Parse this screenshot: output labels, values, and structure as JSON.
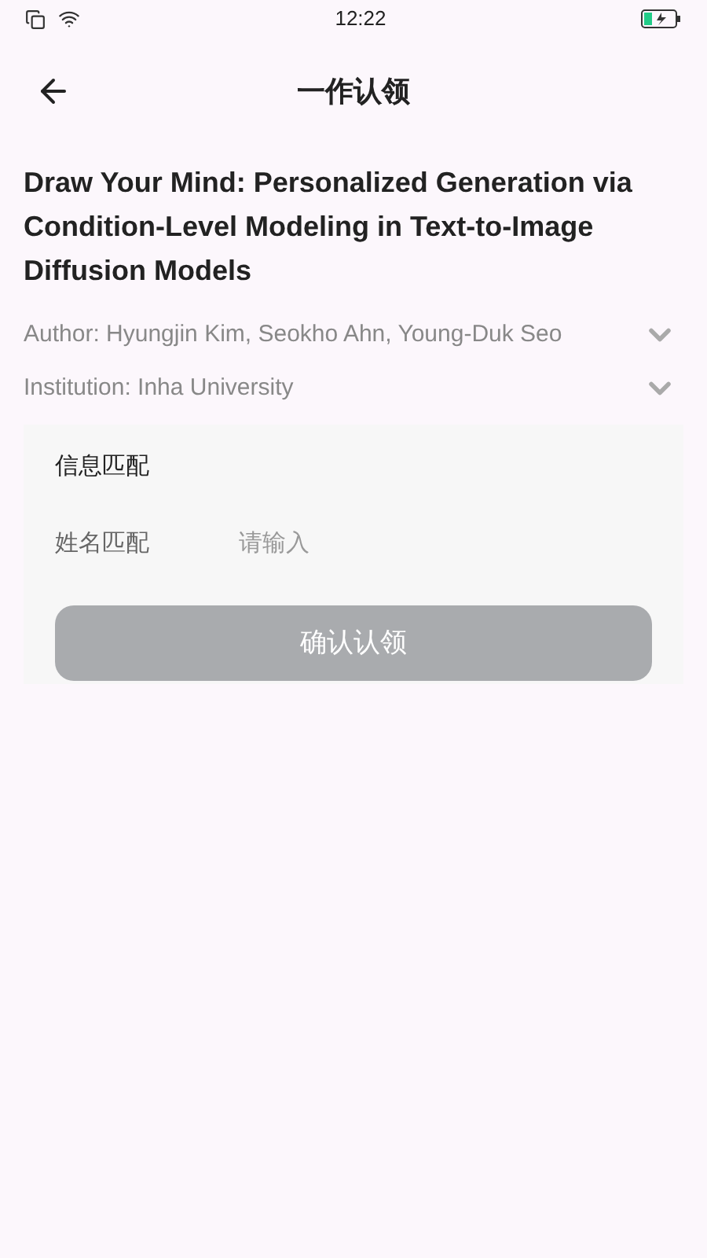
{
  "status_bar": {
    "time": "12:22"
  },
  "header": {
    "title": "一作认领"
  },
  "paper": {
    "title": "Draw Your Mind: Personalized Generation via Condition-Level Modeling in Text-to-Image Diffusion Models",
    "details": [
      {
        "text": "Author: Hyungjin Kim, Seokho Ahn, Young-Duk Seo",
        "expanded": false
      },
      {
        "text": "Institution: Inha University",
        "expanded": false
      }
    ]
  },
  "match_card": {
    "heading": "信息匹配",
    "field": {
      "label": "姓名匹配",
      "placeholder": "请输入"
    },
    "button": {
      "label": "确认认领",
      "disabled": true
    }
  }
}
